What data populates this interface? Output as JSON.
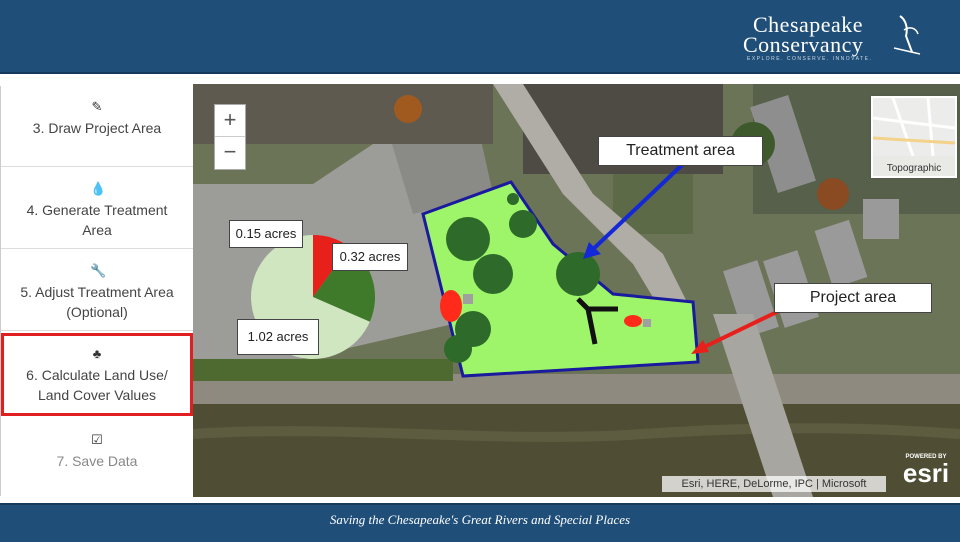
{
  "brand": {
    "name_line1": "Chesapeake",
    "name_line2": "Conservancy",
    "tagline": "EXPLORE. CONSERVE. INNOVATE.",
    "colors": {
      "header_bg": "#1f4e79",
      "active_outline": "#e02020",
      "arrow_blue": "#1428d8",
      "arrow_red": "#e8201c"
    }
  },
  "sidebar": {
    "steps": [
      {
        "icon": "pencil-icon",
        "label": "3. Draw Project Area"
      },
      {
        "icon": "drop-icon",
        "label": "4. Generate Treatment Area"
      },
      {
        "icon": "wrench-icon",
        "label": "5. Adjust Treatment Area (Optional)"
      },
      {
        "icon": "tree-icon",
        "label": "6. Calculate Land Use/ Land Cover Values"
      },
      {
        "icon": "checkbox-icon",
        "label": "7. Save Data"
      }
    ]
  },
  "map": {
    "zoom_in": "+",
    "zoom_out": "−",
    "basemap_label": "Topographic",
    "attribution": "Esri, HERE, DeLorme, IPC | Microsoft",
    "powered_by": "POWERED BY",
    "esri": "esri"
  },
  "annotations": {
    "treatment_area": "Treatment area",
    "project_area": "Project area",
    "acres_small": "0.15 acres",
    "acres_mid": "0.32 acres",
    "acres_large": "1.02 acres"
  },
  "chart_data": {
    "type": "pie",
    "categories": [
      "0.15 acres",
      "0.32 acres",
      "1.02 acres"
    ],
    "values": [
      0.15,
      0.32,
      1.02
    ],
    "colors": [
      "#e8201c",
      "#3f7a2a",
      "#cfe6c0"
    ]
  },
  "footer": {
    "text": "Saving the Chesapeake's Great Rivers and Special Places"
  }
}
